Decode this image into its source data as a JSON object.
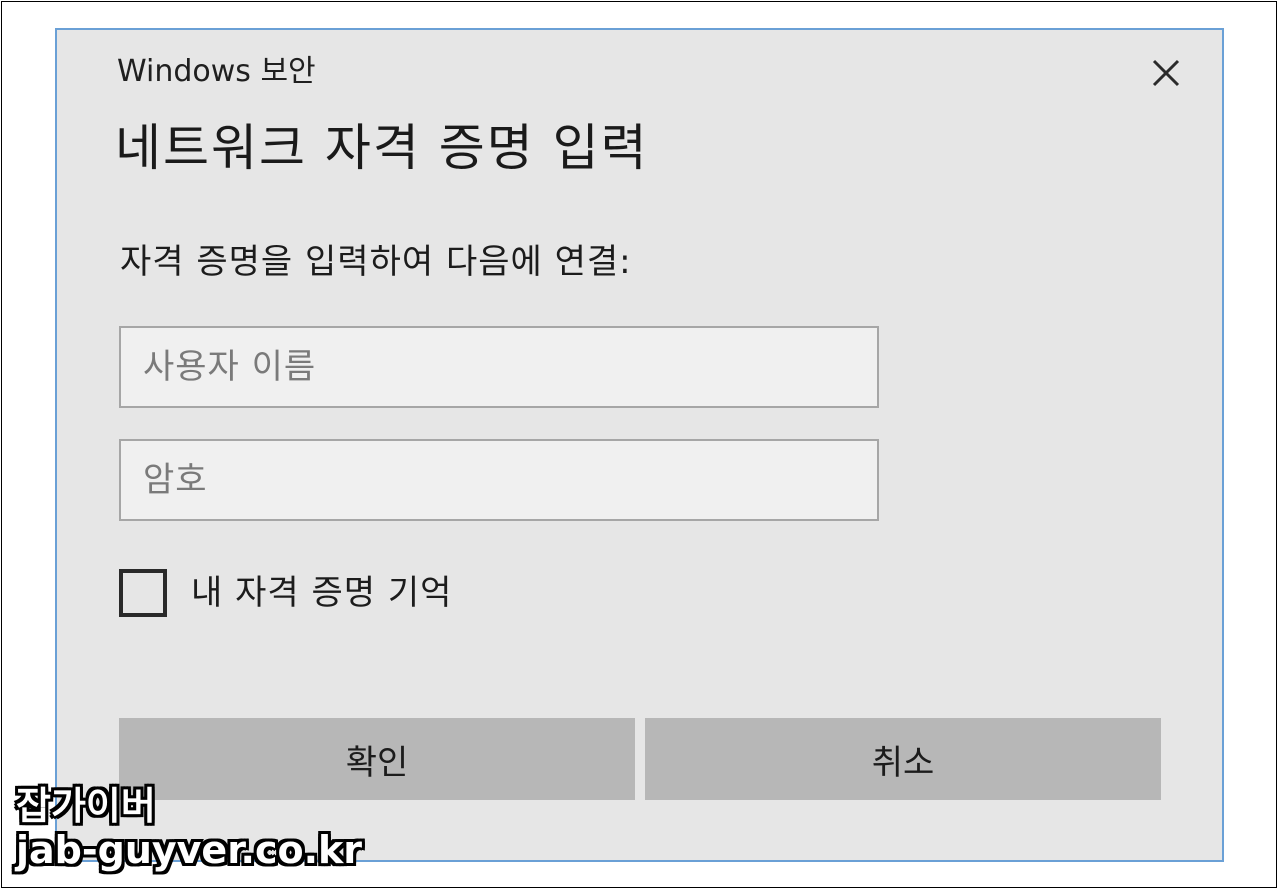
{
  "dialog": {
    "window_title": "Windows 보안",
    "close_icon": "close-icon",
    "heading": "네트워크 자격 증명 입력",
    "prompt": "자격 증명을 입력하여 다음에 연결:",
    "username": {
      "placeholder": "사용자 이름",
      "value": ""
    },
    "password": {
      "placeholder": "암호",
      "value": ""
    },
    "remember": {
      "label": "내 자격 증명 기억",
      "checked": false
    },
    "buttons": {
      "ok_label": "확인",
      "cancel_label": "취소"
    }
  },
  "watermark": {
    "line1": "잡가이버",
    "line2": "jab-guyver.co.kr"
  },
  "colors": {
    "dialog_background": "#e6e6e6",
    "dialog_border": "#6aa0d6",
    "input_background": "#f0f0f0",
    "button_background": "#b7b7b7"
  }
}
